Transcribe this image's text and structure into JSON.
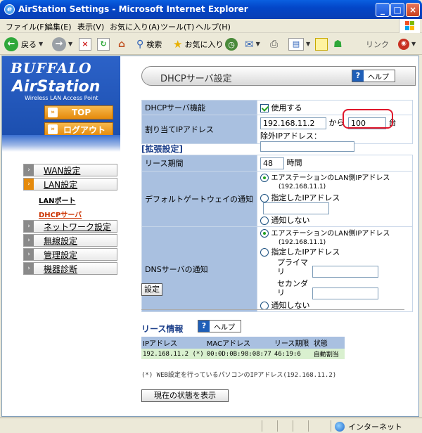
{
  "window": {
    "title": "AirStation Settings - Microsoft Internet Explorer",
    "controls": [
      "_",
      "□",
      "×"
    ]
  },
  "menu": [
    "ファイル(F)",
    "編集(E)",
    "表示(V)",
    "お気に入り(A)",
    "ツール(T)",
    "ヘルプ(H)"
  ],
  "toolbar": {
    "back": "戻る",
    "search": "検索",
    "favorites": "お気に入り",
    "links": "リンク"
  },
  "sidebar": {
    "brand": "BUFFALO",
    "product": "AirStation",
    "tagline": "Wireless LAN Access Point",
    "top_button": "TOP",
    "logout_button": "ログアウト",
    "nav": [
      {
        "label": "WAN設定"
      },
      {
        "label": "LAN設定"
      },
      {
        "label": "ネットワーク設定"
      },
      {
        "label": "無線設定"
      },
      {
        "label": "管理設定"
      },
      {
        "label": "機器診断"
      }
    ],
    "sub": [
      {
        "label": "LANポート"
      },
      {
        "label": "DHCPサーバ"
      }
    ]
  },
  "main": {
    "title": "DHCPサーバ設定",
    "help": "ヘルプ",
    "dhcp_function_label": "DHCPサーバ機能",
    "dhcp_function_value": "使用する",
    "assign_label": "割り当てIPアドレス",
    "assign_ip": "192.168.11.2",
    "assign_from": "から",
    "assign_count": "100",
    "assign_unit": "台",
    "exclude_label": "除外IPアドレス：",
    "advanced_title": "[拡張設定]",
    "lease_label": "リース期間",
    "lease_value": "48",
    "lease_unit": "時間",
    "gateway_label": "デフォルトゲートウェイの通知",
    "gateway_opt1": "エアステーションのLAN側IPアドレス",
    "gateway_opt1_ip": "(192.168.11.1)",
    "gateway_opt2": "指定したIPアドレス",
    "gateway_opt3": "通知しない",
    "dns_label": "DNSサーバの通知",
    "dns_opt1": "エアステーションのLAN側IPアドレス",
    "dns_opt1_ip": "(192.168.11.1)",
    "dns_opt2": "指定したIPアドレス",
    "dns_primary": "プライマリ",
    "dns_secondary": "セカンダリ",
    "dns_opt3": "通知しない",
    "submit": "設定",
    "lease_info_title": "リース情報",
    "lease_info_help": "ヘルプ",
    "lease_table": {
      "headers": [
        "IPアドレス",
        "MACアドレス",
        "リース期限",
        "状態"
      ],
      "rows": [
        [
          "192.168.11.2 (*)",
          "00:0D:0B:98:08:77",
          "46:19:6",
          "自動割当"
        ]
      ]
    },
    "note": "(*) WEB設定を行っているパソコンのIPアドレス(192.168.11.2)",
    "refresh": "現在の状態を表示"
  },
  "status": {
    "zone": "インターネット"
  },
  "colors": {
    "label_bg": "#a9c0e0",
    "accent_orange": "#e58a0c",
    "highlight_red": "#e0162b"
  }
}
